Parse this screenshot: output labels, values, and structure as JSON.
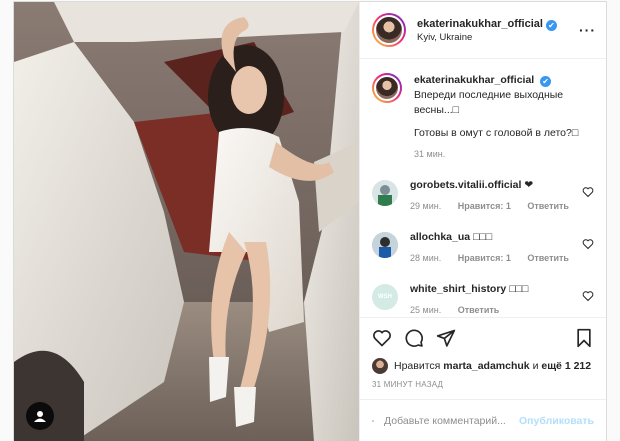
{
  "post": {
    "author": "ekaterinakukhar_official",
    "location": "Kyiv, Ukraine",
    "verified_mark": "✔",
    "more_label": "···"
  },
  "caption": {
    "user": "ekaterinakukhar_official",
    "line1": "Впереди последние выходные весны...□",
    "line2": "Готовы в омут с головой в лето?□",
    "time": "31 мин."
  },
  "comments": [
    {
      "user": "gorobets.vitalii.official",
      "text": "❤",
      "time": "29 мин.",
      "likes": "Нравится: 1",
      "reply": "Ответить",
      "avatar_color": "#d8e4e6"
    },
    {
      "user": "allochka_ua",
      "text": "□□□",
      "time": "28 мин.",
      "likes": "Нравится: 1",
      "reply": "Ответить",
      "avatar_color": "#cfd8dc"
    },
    {
      "user": "white_shirt_history",
      "text": "□□□",
      "time": "25 мин.",
      "likes": "",
      "reply": "Ответить",
      "avatar_color": "#d3ebe4",
      "avatar_text": "WSH"
    }
  ],
  "actions": {
    "likes_prefix": "Нравится",
    "liked_by": "marta_adamchuk",
    "likes_connector": "и",
    "likes_more": "ещё 1 212",
    "time_ago": "31 МИНУТ НАЗАД"
  },
  "comment_box": {
    "placeholder": "Добавьте комментарий...",
    "publish_label": "Опубликовать"
  },
  "colors": {
    "verified": "#3897f0",
    "publish": "#b2dffc",
    "muted": "#8e8e8e"
  },
  "icons": [
    "heart-icon",
    "comment-icon",
    "share-icon",
    "bookmark-icon",
    "emoji-icon",
    "user-tag-icon",
    "more-icon"
  ]
}
